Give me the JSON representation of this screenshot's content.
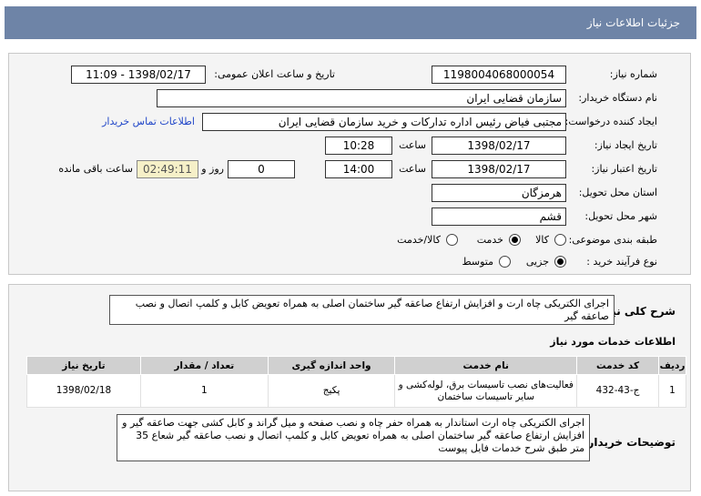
{
  "page_title": "جزئیات اطلاعات نیاز",
  "need_number_label": "شماره نیاز:",
  "need_number": "1198004068000054",
  "announce_label": "تاریخ و ساعت اعلان عمومی:",
  "announce_value": "1398/02/17 - 11:09",
  "buyer_org_label": "نام دستگاه خریدار:",
  "buyer_org": "سازمان قضایی ایران",
  "creator_label": "ایجاد کننده درخواست:",
  "creator": "مجتبی  فیاض رئیس اداره تدارکات و خرید سازمان قضایی ایران",
  "contact_link": "اطلاعات تماس خریدار",
  "create_date_label": "تاریخ ایجاد نیاز:",
  "create_date": "1398/02/17",
  "time_label": "ساعت",
  "create_time": "10:28",
  "validity_label": "تاریخ اعتبار نیاز:",
  "validity_date": "1398/02/17",
  "validity_time": "14:00",
  "days_value": "0",
  "days_and_label": "روز و",
  "remaining_time": "02:49:11",
  "remaining_label": "ساعت باقی مانده",
  "province_label": "استان محل تحویل:",
  "province": "هرمزگان",
  "city_label": "شهر محل تحویل:",
  "city": "قشم",
  "category_label": "طبقه بندی موضوعی:",
  "category_options": [
    "کالا",
    "خدمت",
    "کالا/خدمت"
  ],
  "category_selected": "خدمت",
  "process_label": "نوع فرآیند خرید :",
  "process_options": [
    "جزیی",
    "متوسط"
  ],
  "process_selected": "جزیی",
  "general_desc_label": "شرح کلی نیاز:",
  "general_desc": "اجرای الکتریکی چاه ارت و افزایش ارتفاع صاعقه گیر ساختمان اصلی به همراه تعویض کابل و کلمپ اتصال و نصب صاعقه گیر",
  "services_title": "اطلاعات خدمات مورد نیاز",
  "table": {
    "headers": [
      "ردیف",
      "کد خدمت",
      "نام خدمت",
      "واحد اندازه گیری",
      "تعداد / مقدار",
      "تاریخ نیاز"
    ],
    "rows": [
      [
        "1",
        "ج-43-432",
        "فعالیت‌های نصب تاسیسات برق، لوله‌کشی و سایر تاسیسات ساختمان",
        "پکیج",
        "1",
        "1398/02/18"
      ]
    ]
  },
  "buyer_notes_label": "توضیحات خریدار:",
  "buyer_notes": "اجرای الکتریکی چاه ارت استاندار به همراه حفر چاه و نصب صفحه و میل گراند و کابل کشی جهت صاعقه گیر و افزایش ارتفاع صاعقه گیر ساختمان اصلی به همراه تعویض کابل و کلمپ اتصال و نصب صاعقه گیر شعاع 35 متر طبق شرح خدمات فایل پیوست",
  "colors": {
    "header_bg": "#6e84a7",
    "panel_bg": "#f4f4f4",
    "link": "#2046c8"
  }
}
